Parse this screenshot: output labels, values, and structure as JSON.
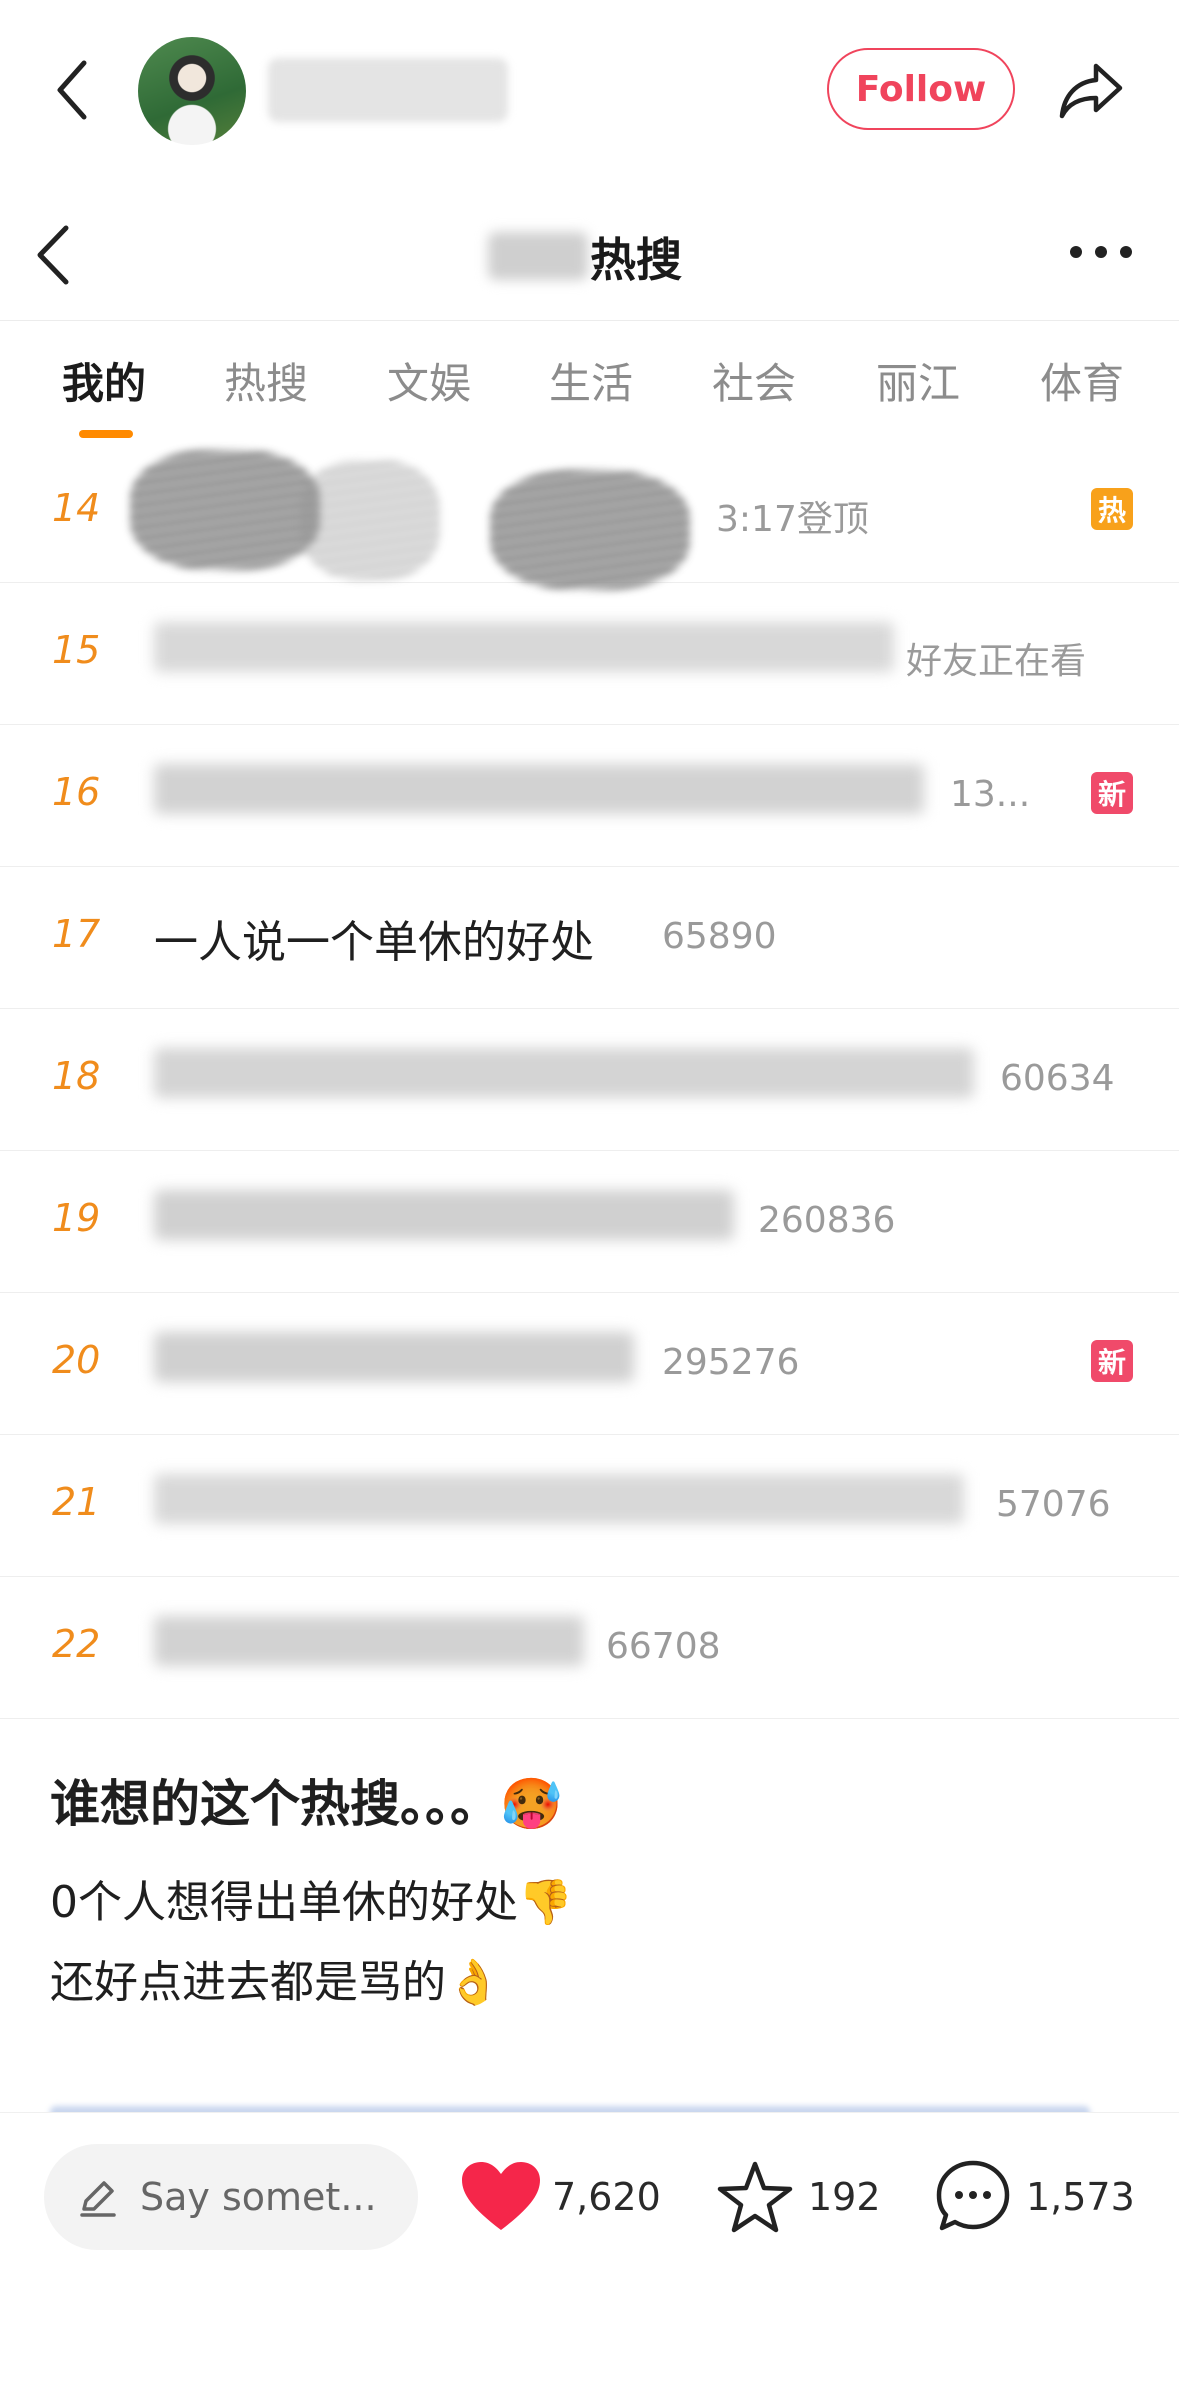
{
  "header": {
    "follow_label": "Follow"
  },
  "screenshot": {
    "title": "热搜",
    "tabs": [
      "我的",
      "热搜",
      "文娱",
      "生活",
      "社会",
      "丽江",
      "体育"
    ],
    "rows": [
      {
        "rank": "14",
        "topic": "",
        "meta": "3:17登顶",
        "badge": "热"
      },
      {
        "rank": "15",
        "topic": "",
        "meta": "好友正在看",
        "badge": ""
      },
      {
        "rank": "16",
        "topic": "",
        "meta": "13...",
        "badge": "新"
      },
      {
        "rank": "17",
        "topic": "一人说一个单休的好处",
        "meta": "65890",
        "badge": ""
      },
      {
        "rank": "18",
        "topic": "",
        "meta": "60634",
        "badge": ""
      },
      {
        "rank": "19",
        "topic": "",
        "meta": "260836",
        "badge": ""
      },
      {
        "rank": "20",
        "topic": "",
        "meta": "295276",
        "badge": "新"
      },
      {
        "rank": "21",
        "topic": "",
        "meta": "57076",
        "badge": ""
      },
      {
        "rank": "22",
        "topic": "",
        "meta": "66708",
        "badge": ""
      }
    ]
  },
  "post": {
    "title": "谁想的这个热搜。。。🥵",
    "lines": [
      "0个人想得出单休的好处👎",
      "还好点进去都是骂的👌"
    ]
  },
  "bottom": {
    "say_placeholder": "Say somet...",
    "likes": "7,620",
    "stars": "192",
    "comments": "1,573"
  },
  "colors": {
    "accent": "#f0445c",
    "rank": "#f08c1c",
    "hot_badge": "#f8a11b",
    "new_badge": "#f04a6a"
  }
}
